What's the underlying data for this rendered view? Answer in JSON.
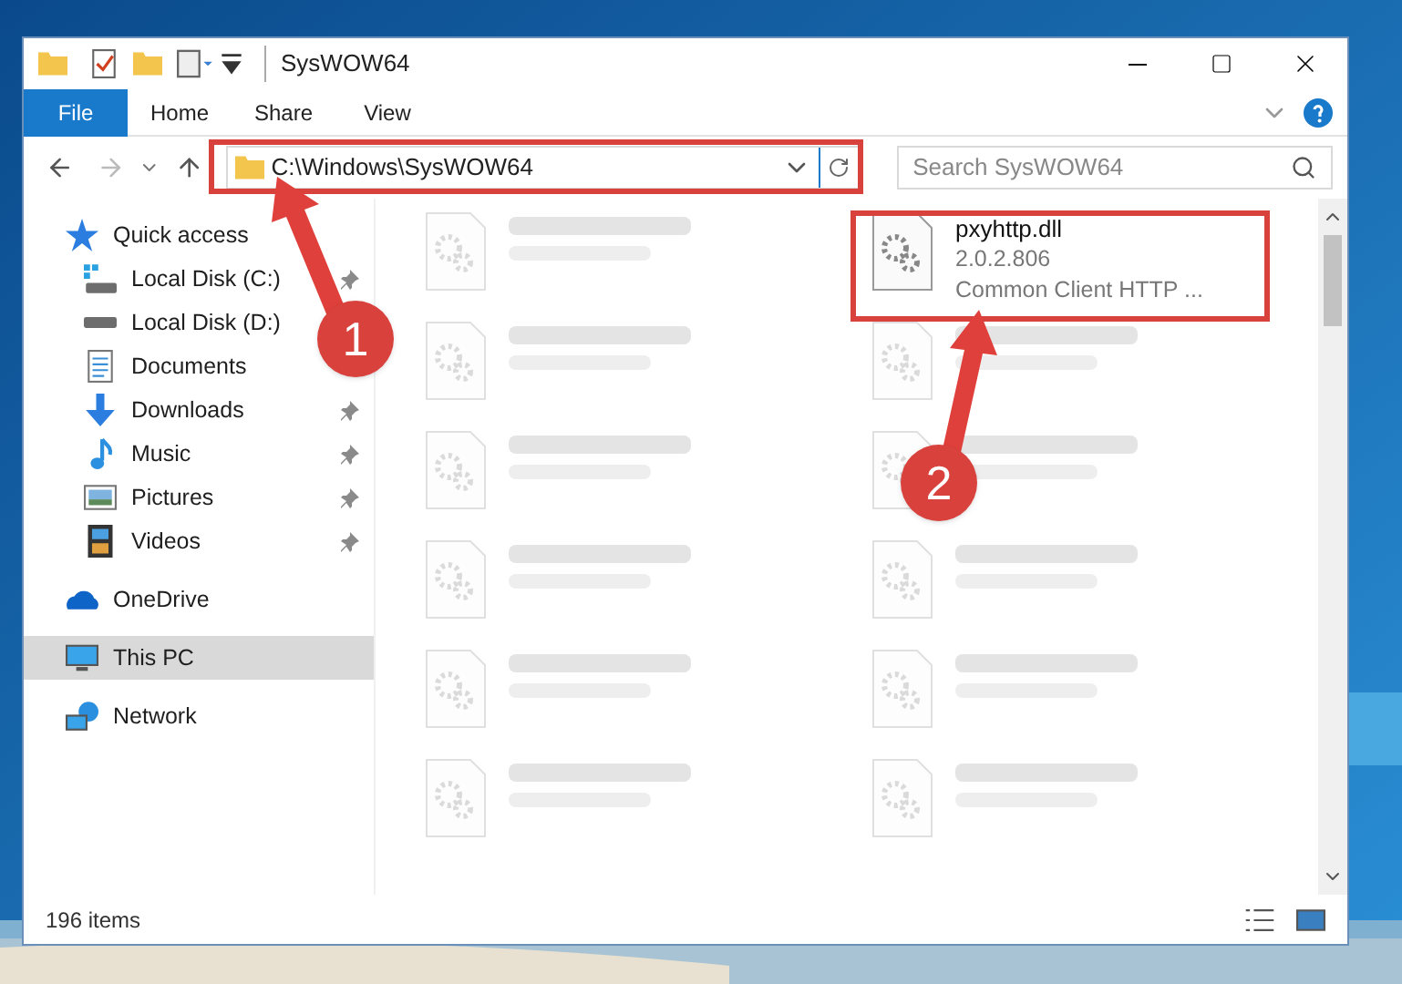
{
  "window": {
    "title": "SysWOW64"
  },
  "ribbon_tabs": [
    {
      "label": "File",
      "selected": true
    },
    {
      "label": "Home",
      "selected": false
    },
    {
      "label": "Share",
      "selected": false
    },
    {
      "label": "View",
      "selected": false
    }
  ],
  "address": {
    "value": "C:\\Windows\\SysWOW64"
  },
  "search": {
    "placeholder": "Search SysWOW64"
  },
  "sidebar": {
    "items": [
      {
        "label": "Quick access",
        "kind": "star",
        "selected": false,
        "children": [
          {
            "label": "Local Disk (C:)",
            "kind": "drive-c",
            "pinned": true,
            "selected": false
          },
          {
            "label": "Local Disk (D:)",
            "kind": "drive",
            "pinned": false,
            "selected": false
          },
          {
            "label": "Documents",
            "kind": "documents",
            "pinned": false,
            "selected": false
          },
          {
            "label": "Downloads",
            "kind": "downloads",
            "pinned": true,
            "selected": false
          },
          {
            "label": "Music",
            "kind": "music",
            "pinned": true,
            "selected": false
          },
          {
            "label": "Pictures",
            "kind": "pictures",
            "pinned": true,
            "selected": false
          },
          {
            "label": "Videos",
            "kind": "videos",
            "pinned": true,
            "selected": false
          }
        ]
      },
      {
        "label": "OneDrive",
        "kind": "cloud",
        "selected": false
      },
      {
        "label": "This PC",
        "kind": "pc",
        "selected": true
      },
      {
        "label": "Network",
        "kind": "network",
        "selected": false
      }
    ]
  },
  "files": [
    {
      "blurred": true
    },
    {
      "name": "pxyhttp.dll",
      "lines": [
        "2.0.2.806",
        "Common Client HTTP ..."
      ],
      "blurred": false
    },
    {
      "blurred": true
    },
    {
      "blurred": true
    },
    {
      "blurred": true
    },
    {
      "blurred": true
    },
    {
      "blurred": true
    },
    {
      "blurred": true
    },
    {
      "blurred": true
    },
    {
      "blurred": true
    },
    {
      "blurred": true
    },
    {
      "blurred": true
    }
  ],
  "status_bar": {
    "count": "196 items"
  },
  "annotations": [
    {
      "number": "1"
    },
    {
      "number": "2"
    }
  ]
}
